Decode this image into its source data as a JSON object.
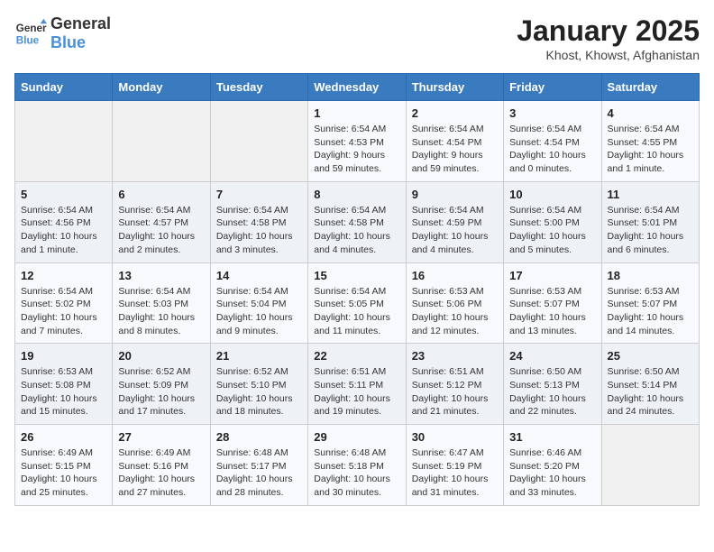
{
  "logo": {
    "line1": "General",
    "line2": "Blue"
  },
  "title": "January 2025",
  "subtitle": "Khost, Khowst, Afghanistan",
  "days_of_week": [
    "Sunday",
    "Monday",
    "Tuesday",
    "Wednesday",
    "Thursday",
    "Friday",
    "Saturday"
  ],
  "weeks": [
    [
      {
        "day": "",
        "info": ""
      },
      {
        "day": "",
        "info": ""
      },
      {
        "day": "",
        "info": ""
      },
      {
        "day": "1",
        "info": "Sunrise: 6:54 AM\nSunset: 4:53 PM\nDaylight: 9 hours and 59 minutes."
      },
      {
        "day": "2",
        "info": "Sunrise: 6:54 AM\nSunset: 4:54 PM\nDaylight: 9 hours and 59 minutes."
      },
      {
        "day": "3",
        "info": "Sunrise: 6:54 AM\nSunset: 4:54 PM\nDaylight: 10 hours and 0 minutes."
      },
      {
        "day": "4",
        "info": "Sunrise: 6:54 AM\nSunset: 4:55 PM\nDaylight: 10 hours and 1 minute."
      }
    ],
    [
      {
        "day": "5",
        "info": "Sunrise: 6:54 AM\nSunset: 4:56 PM\nDaylight: 10 hours and 1 minute."
      },
      {
        "day": "6",
        "info": "Sunrise: 6:54 AM\nSunset: 4:57 PM\nDaylight: 10 hours and 2 minutes."
      },
      {
        "day": "7",
        "info": "Sunrise: 6:54 AM\nSunset: 4:58 PM\nDaylight: 10 hours and 3 minutes."
      },
      {
        "day": "8",
        "info": "Sunrise: 6:54 AM\nSunset: 4:58 PM\nDaylight: 10 hours and 4 minutes."
      },
      {
        "day": "9",
        "info": "Sunrise: 6:54 AM\nSunset: 4:59 PM\nDaylight: 10 hours and 4 minutes."
      },
      {
        "day": "10",
        "info": "Sunrise: 6:54 AM\nSunset: 5:00 PM\nDaylight: 10 hours and 5 minutes."
      },
      {
        "day": "11",
        "info": "Sunrise: 6:54 AM\nSunset: 5:01 PM\nDaylight: 10 hours and 6 minutes."
      }
    ],
    [
      {
        "day": "12",
        "info": "Sunrise: 6:54 AM\nSunset: 5:02 PM\nDaylight: 10 hours and 7 minutes."
      },
      {
        "day": "13",
        "info": "Sunrise: 6:54 AM\nSunset: 5:03 PM\nDaylight: 10 hours and 8 minutes."
      },
      {
        "day": "14",
        "info": "Sunrise: 6:54 AM\nSunset: 5:04 PM\nDaylight: 10 hours and 9 minutes."
      },
      {
        "day": "15",
        "info": "Sunrise: 6:54 AM\nSunset: 5:05 PM\nDaylight: 10 hours and 11 minutes."
      },
      {
        "day": "16",
        "info": "Sunrise: 6:53 AM\nSunset: 5:06 PM\nDaylight: 10 hours and 12 minutes."
      },
      {
        "day": "17",
        "info": "Sunrise: 6:53 AM\nSunset: 5:07 PM\nDaylight: 10 hours and 13 minutes."
      },
      {
        "day": "18",
        "info": "Sunrise: 6:53 AM\nSunset: 5:07 PM\nDaylight: 10 hours and 14 minutes."
      }
    ],
    [
      {
        "day": "19",
        "info": "Sunrise: 6:53 AM\nSunset: 5:08 PM\nDaylight: 10 hours and 15 minutes."
      },
      {
        "day": "20",
        "info": "Sunrise: 6:52 AM\nSunset: 5:09 PM\nDaylight: 10 hours and 17 minutes."
      },
      {
        "day": "21",
        "info": "Sunrise: 6:52 AM\nSunset: 5:10 PM\nDaylight: 10 hours and 18 minutes."
      },
      {
        "day": "22",
        "info": "Sunrise: 6:51 AM\nSunset: 5:11 PM\nDaylight: 10 hours and 19 minutes."
      },
      {
        "day": "23",
        "info": "Sunrise: 6:51 AM\nSunset: 5:12 PM\nDaylight: 10 hours and 21 minutes."
      },
      {
        "day": "24",
        "info": "Sunrise: 6:50 AM\nSunset: 5:13 PM\nDaylight: 10 hours and 22 minutes."
      },
      {
        "day": "25",
        "info": "Sunrise: 6:50 AM\nSunset: 5:14 PM\nDaylight: 10 hours and 24 minutes."
      }
    ],
    [
      {
        "day": "26",
        "info": "Sunrise: 6:49 AM\nSunset: 5:15 PM\nDaylight: 10 hours and 25 minutes."
      },
      {
        "day": "27",
        "info": "Sunrise: 6:49 AM\nSunset: 5:16 PM\nDaylight: 10 hours and 27 minutes."
      },
      {
        "day": "28",
        "info": "Sunrise: 6:48 AM\nSunset: 5:17 PM\nDaylight: 10 hours and 28 minutes."
      },
      {
        "day": "29",
        "info": "Sunrise: 6:48 AM\nSunset: 5:18 PM\nDaylight: 10 hours and 30 minutes."
      },
      {
        "day": "30",
        "info": "Sunrise: 6:47 AM\nSunset: 5:19 PM\nDaylight: 10 hours and 31 minutes."
      },
      {
        "day": "31",
        "info": "Sunrise: 6:46 AM\nSunset: 5:20 PM\nDaylight: 10 hours and 33 minutes."
      },
      {
        "day": "",
        "info": ""
      }
    ]
  ]
}
